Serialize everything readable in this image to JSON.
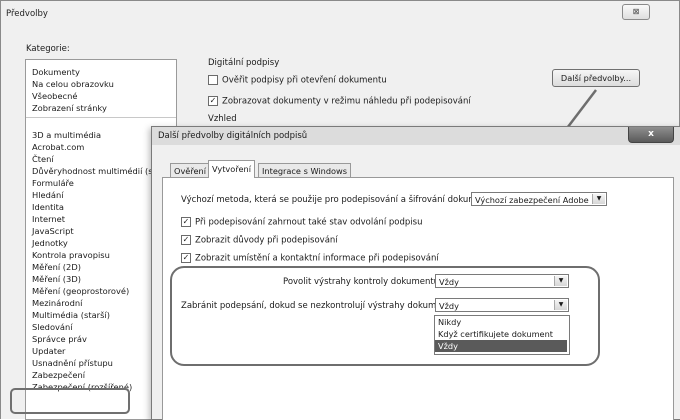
{
  "window": {
    "title": "Předvolby",
    "close_label": "⊠"
  },
  "categories": {
    "label": "Kategorie:",
    "group1": [
      "Dokumenty",
      "Na celou obrazovku",
      "Všeobecné",
      "Zobrazení stránky"
    ],
    "group2": [
      "3D a multimédia",
      "Acrobat.com",
      "Čtení",
      "Důvěryhodnost multimédií (sta",
      "Formuláře",
      "Hledání",
      "Identita",
      "Internet",
      "JavaScript",
      "Jednotky",
      "Kontrola pravopisu",
      "Měření (2D)",
      "Měření (3D)",
      "Měření (geoprostorové)",
      "Mezinárodní",
      "Multimédia (starší)",
      "Sledování",
      "Správce práv",
      "Updater",
      "Usnadnění přístupu",
      "Zabezpečení",
      "Zabezpečení (rozšířené)"
    ],
    "selected": "Zabezpečení"
  },
  "digital_signatures": {
    "header": "Digitální podpisy",
    "verify_label": "Ověřit podpisy při otevření dokumentu",
    "verify_checked": false,
    "preview_label": "Zobrazovat dokumenty v režimu náhledu při podepisování",
    "preview_checked": true,
    "appearance_label": "Vzhled",
    "more_button": "Další předvolby..."
  },
  "dialog": {
    "title": "Další předvolby digitálních podpisů",
    "close_label": "x",
    "tabs": [
      "Ověření",
      "Vytvoření",
      "Integrace s Windows"
    ],
    "active_tab": "Vytvoření",
    "default_method_label": "Výchozí metoda, která se použije pro podepisování a šifrování dokumentů:",
    "default_method_value": "Výchozí zabezpečení Adobe",
    "checkboxes": [
      {
        "label": "Při podepisování zahrnout také stav odvolání podpisu",
        "checked": true
      },
      {
        "label": "Zobrazit důvody při podepisování",
        "checked": true
      },
      {
        "label": "Zobrazit umístění a kontaktní informace při podepisování",
        "checked": true
      }
    ],
    "allow_warnings_label": "Povolit výstrahy kontroly dokumentu:",
    "allow_warnings_value": "Vždy",
    "prevent_signing_label": "Zabránit podepsání, dokud se nezkontrolují výstrahy dokumentu:",
    "prevent_signing_value": "Vždy",
    "dropdown_options": [
      "Nikdy",
      "Když certifikujete dokument",
      "Vždy"
    ],
    "dropdown_selected": "Vždy"
  },
  "colors": {
    "highlight": "#5a5a5a",
    "annotation": "#6e6e6e"
  }
}
